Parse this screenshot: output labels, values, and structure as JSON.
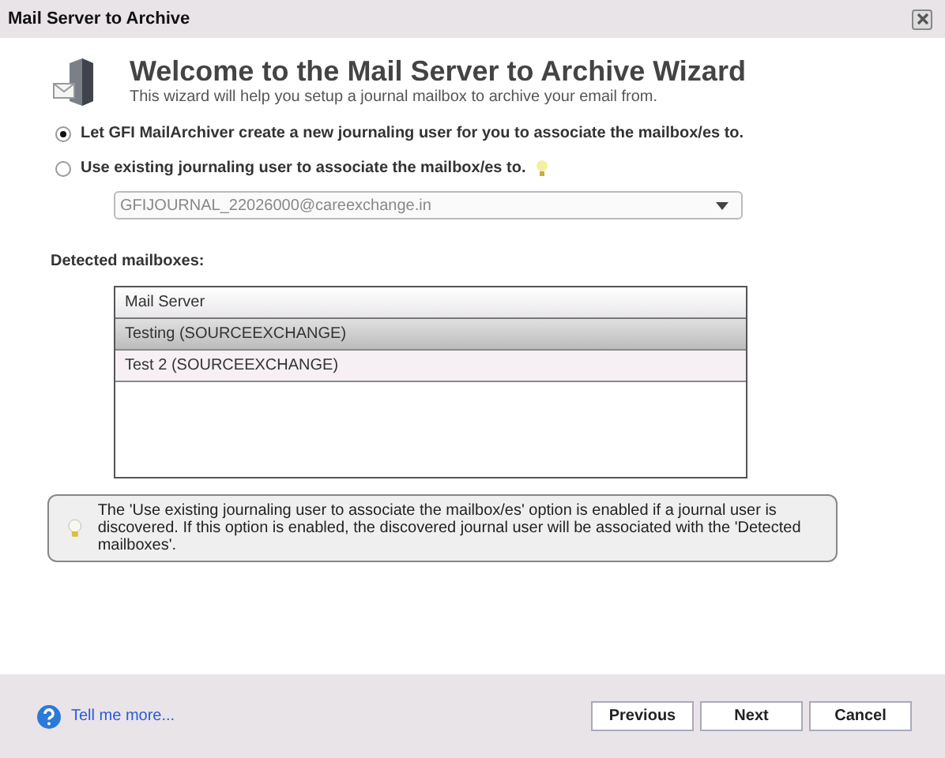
{
  "window": {
    "title": "Mail Server to Archive"
  },
  "header": {
    "title": "Welcome to the Mail Server to Archive Wizard",
    "subtitle": "This wizard will help you setup a journal mailbox to archive your email from."
  },
  "options": [
    {
      "label": "Let GFI MailArchiver create a new journaling user for you to associate the mailbox/es to.",
      "selected": true,
      "hint": false
    },
    {
      "label": "Use existing journaling user to associate the mailbox/es to.",
      "selected": false,
      "hint": true
    }
  ],
  "journal_user": {
    "value": "GFIJOURNAL_22026000@careexchange.in",
    "disabled": true
  },
  "mailboxes": {
    "label": "Detected mailboxes:",
    "column": "Mail Server",
    "rows": [
      {
        "name": "Testing (SOURCEEXCHANGE)",
        "selected": true
      },
      {
        "name": "Test 2 (SOURCEEXCHANGE)",
        "selected": false
      }
    ]
  },
  "info": "The 'Use existing journaling user to associate the mailbox/es' option is enabled if a journal user is discovered. If this option is enabled, the discovered journal user will be associated with the 'Detected mailboxes'.",
  "footer": {
    "help_link": "Tell me more...",
    "buttons": [
      "Previous",
      "Next",
      "Cancel"
    ]
  }
}
